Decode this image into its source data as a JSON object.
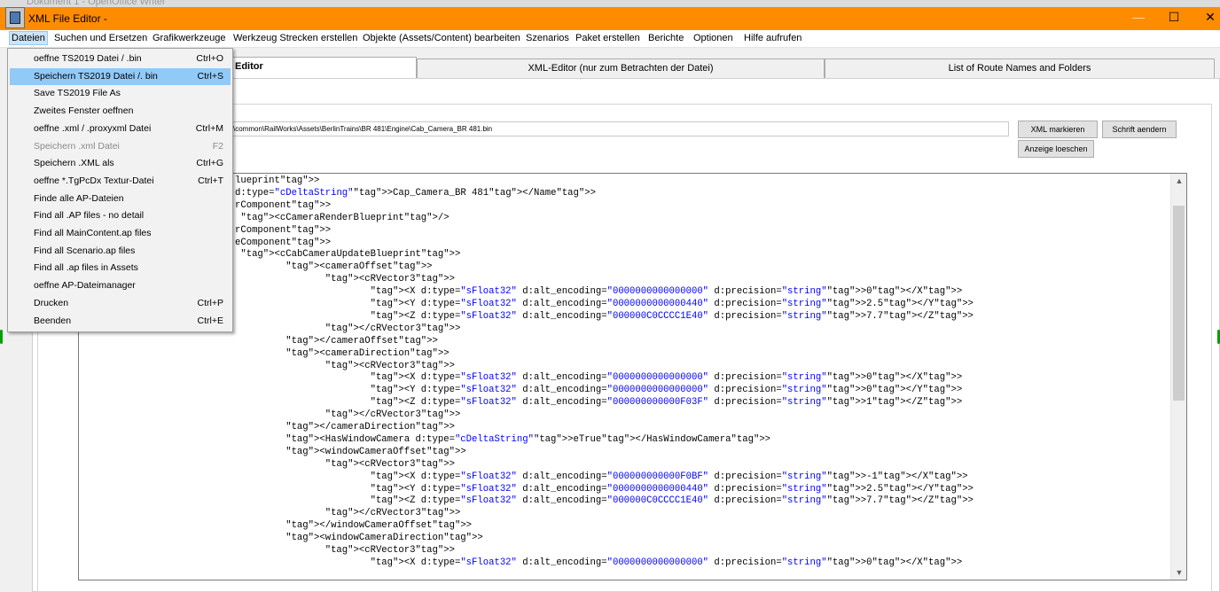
{
  "background_window": {
    "title": "Dokument 1 - OpenOffice Writer"
  },
  "window": {
    "title": "XML File Editor -",
    "minimize": "—",
    "maximize": "☐",
    "close": "✕",
    "accent_color": "#ff8c00"
  },
  "menubar": {
    "items": [
      "Dateien",
      "Suchen und Ersetzen",
      "Grafikwerkzeuge",
      "Werkzeug Strecken erstellen",
      "Objekte (Assets/Content) bearbeiten",
      "Szenarios",
      "Paket erstellen",
      "Berichte",
      "Optionen",
      "Hilfe aufrufen"
    ]
  },
  "tabs": [
    {
      "label": "Editor"
    },
    {
      "label": "XML-Editor (nur zum Betrachten der Datei)"
    },
    {
      "label": "List of Route Names and Folders"
    }
  ],
  "path": "s\\common\\RailWorks\\Assets\\BerlinTrains\\BR 481\\Engine\\Cab_Camera_BR 481.bin",
  "buttons": {
    "xml_markieren": "XML markieren",
    "schrift_aendern": "Schrift aendern",
    "anzeige_loeschen": "Anzeige loeschen"
  },
  "dropdown": {
    "items": [
      {
        "label": "oeffne TS2019 Datei / .bin",
        "shortcut": "Ctrl+O",
        "disabled": false
      },
      {
        "label": "Speichern TS2019 Datei /. bin",
        "shortcut": "Ctrl+S",
        "disabled": false
      },
      {
        "label": "Save TS2019 File As",
        "shortcut": "",
        "disabled": false
      },
      {
        "label": "Zweites Fenster oeffnen",
        "shortcut": "",
        "disabled": false
      },
      {
        "label": "oeffne .xml / .proxyxml Datei",
        "shortcut": "Ctrl+M",
        "disabled": false
      },
      {
        "label": "Speichern .xml Datei",
        "shortcut": "F2",
        "disabled": true
      },
      {
        "label": "Speichern .XML als",
        "shortcut": "Ctrl+G",
        "disabled": false
      },
      {
        "label": "oeffne *.TgPcDx Textur-Datei",
        "shortcut": "Ctrl+T",
        "disabled": false
      },
      {
        "label": "Finde alle AP-Dateien",
        "shortcut": "",
        "disabled": false
      },
      {
        "label": "Find all .AP files - no detail",
        "shortcut": "",
        "disabled": false
      },
      {
        "label": "Find all MainContent.ap files",
        "shortcut": "",
        "disabled": false
      },
      {
        "label": "Find all Scenario.ap files",
        "shortcut": "",
        "disabled": false
      },
      {
        "label": "Find all .ap files in Assets",
        "shortcut": "",
        "disabled": false
      },
      {
        "label": "oeffne AP-Dateimanager",
        "shortcut": "",
        "disabled": false
      },
      {
        "label": "Drucken",
        "shortcut": "Ctrl+P",
        "disabled": false
      },
      {
        "label": "Beenden",
        "shortcut": "Ctrl+E",
        "disabled": false
      }
    ],
    "highlighted_index": 1
  },
  "editor_lines": [
    "lueprint>",
    "d:type=\"cDeltaString\">Cap_Camera_BR 481</Name>",
    "rComponent>",
    " <cCameraRenderBlueprint/>",
    "rComponent>",
    "eComponent>",
    " <cCabCameraUpdateBlueprint>",
    "         <cameraOffset>",
    "                <cRVector3>",
    "                        <X d:type=\"sFloat32\" d:alt_encoding=\"0000000000000000\" d:precision=\"string\">0</X>",
    "                        <Y d:type=\"sFloat32\" d:alt_encoding=\"0000000000000440\" d:precision=\"string\">2.5</Y>",
    "                        <Z d:type=\"sFloat32\" d:alt_encoding=\"000000C0CCCC1E40\" d:precision=\"string\">7.7</Z>",
    "                </cRVector3>",
    "         </cameraOffset>",
    "         <cameraDirection>",
    "                <cRVector3>",
    "                        <X d:type=\"sFloat32\" d:alt_encoding=\"0000000000000000\" d:precision=\"string\">0</X>",
    "                        <Y d:type=\"sFloat32\" d:alt_encoding=\"0000000000000000\" d:precision=\"string\">0</Y>",
    "                        <Z d:type=\"sFloat32\" d:alt_encoding=\"000000000000F03F\" d:precision=\"string\">1</Z>",
    "                </cRVector3>",
    "         </cameraDirection>",
    "         <HasWindowCamera d:type=\"cDeltaString\">eTrue</HasWindowCamera>",
    "         <windowCameraOffset>",
    "                <cRVector3>",
    "                        <X d:type=\"sFloat32\" d:alt_encoding=\"000000000000F0BF\" d:precision=\"string\">-1</X>",
    "                        <Y d:type=\"sFloat32\" d:alt_encoding=\"0000000000000440\" d:precision=\"string\">2.5</Y>",
    "                        <Z d:type=\"sFloat32\" d:alt_encoding=\"000000C0CCCC1E40\" d:precision=\"string\">7.7</Z>",
    "                </cRVector3>",
    "         </windowCameraOffset>",
    "         <windowCameraDirection>",
    "                <cRVector3>",
    "                        <X d:type=\"sFloat32\" d:alt_encoding=\"0000000000000000\" d:precision=\"string\">0</X>"
  ]
}
